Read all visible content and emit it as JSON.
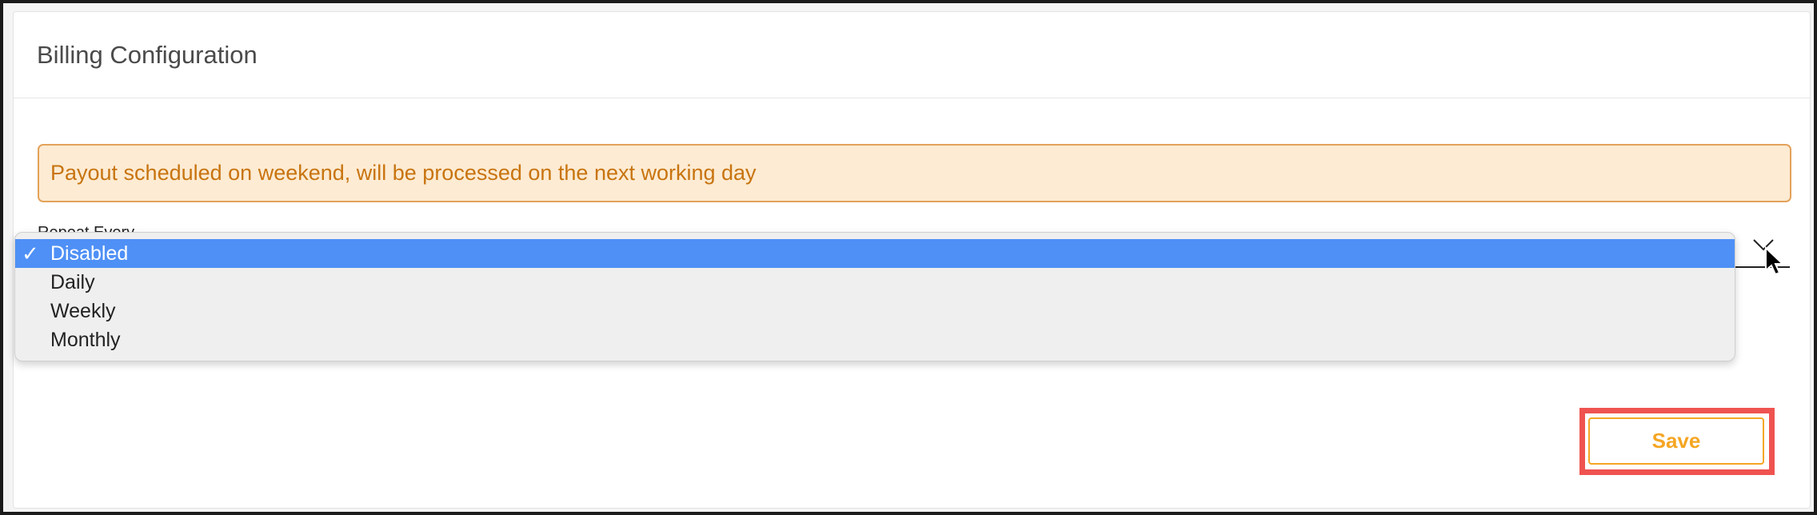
{
  "card": {
    "title": "Billing Configuration"
  },
  "alert": {
    "message": "Payout scheduled on weekend, will be processed on the next working day"
  },
  "repeat_field": {
    "label": "Repeat Every",
    "selected_value": "Disabled",
    "options": [
      {
        "label": "Disabled",
        "selected": true
      },
      {
        "label": "Daily",
        "selected": false
      },
      {
        "label": "Weekly",
        "selected": false
      },
      {
        "label": "Monthly",
        "selected": false
      }
    ],
    "check_glyph": "✓"
  },
  "actions": {
    "save_label": "Save"
  },
  "colors": {
    "accent": "#f5a623",
    "alert_bg": "#fdebd3",
    "alert_text": "#c8740f",
    "selected_option": "#4f90f6",
    "highlight": "#ef5350"
  },
  "icons": {
    "select_arrow": "chevron-down-icon",
    "cursor": "mouse-pointer-icon",
    "check": "checkmark-icon"
  }
}
